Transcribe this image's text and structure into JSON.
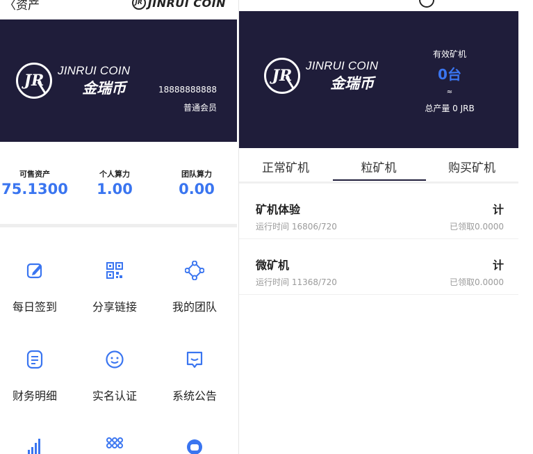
{
  "left": {
    "back_label": "〈资产",
    "brand_en": "JINRUI COIN",
    "brand_cn": "金瑞币",
    "logo_letters": "JR",
    "phone": "18888888888",
    "member_level": "普通会员",
    "stats": [
      {
        "label": "可售资产",
        "value": "75.1300"
      },
      {
        "label": "个人算力",
        "value": "1.00"
      },
      {
        "label": "团队算力",
        "value": "0.00"
      }
    ],
    "menu": [
      {
        "label": "每日签到",
        "icon": "edit-icon"
      },
      {
        "label": "分享链接",
        "icon": "qrcode-icon"
      },
      {
        "label": "我的团队",
        "icon": "team-nodes-icon"
      },
      {
        "label": "财务明细",
        "icon": "document-icon"
      },
      {
        "label": "实名认证",
        "icon": "smile-icon"
      },
      {
        "label": "系统公告",
        "icon": "message-icon"
      }
    ],
    "partial_icons": [
      "signal-bars-icon",
      "grid-dots-icon",
      "headset-icon"
    ]
  },
  "right": {
    "brand_en": "JINRUI COIN",
    "brand_cn": "金瑞币",
    "logo_letters": "JR",
    "effective_label": "有效矿机",
    "effective_value": "0台",
    "approx_symbol": "≈",
    "total_output": "总产量 0 JRB",
    "tabs": [
      "正常矿机",
      "粒矿机",
      "购买矿机"
    ],
    "active_tab": 1,
    "miners": [
      {
        "name": "矿机体验",
        "calc": "计",
        "runtime": "运行时间 16806/720",
        "claimed": "已领取0.0000"
      },
      {
        "name": "微矿机",
        "calc": "计",
        "runtime": "运行时间 11368/720",
        "claimed": "已领取0.0000"
      }
    ]
  },
  "colors": {
    "banner_bg": "#1f1d3a",
    "accent_blue": "#3a75f0"
  }
}
